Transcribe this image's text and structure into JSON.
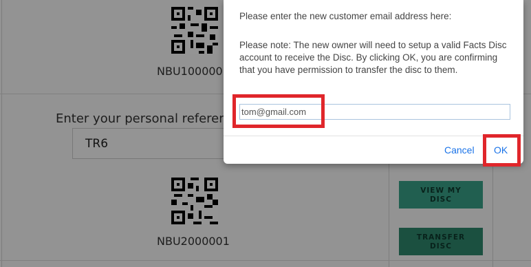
{
  "page": {
    "disc1": {
      "code": "NBU100000"
    },
    "disc2": {
      "reference_label": "Enter your personal reference",
      "reference_value": "TR6",
      "code": "NBU2000001",
      "view_button": [
        "VIEW MY",
        "DISC"
      ],
      "transfer_button": [
        "TRANSFER",
        "DISC"
      ]
    }
  },
  "dialog": {
    "prompt": "Please enter the new customer email address here:",
    "note": "Please note: The new owner will need to setup a valid Facts Disc account to receive the Disc. By clicking OK, you are confirming that you have permission to transfer the disc to them.",
    "email_value": "tom@gmail.com",
    "cancel_label": "Cancel",
    "ok_label": "OK"
  },
  "colors": {
    "annotation": "#e0262b",
    "link_blue": "#1a73e8",
    "button_green": "#3aa48a"
  }
}
